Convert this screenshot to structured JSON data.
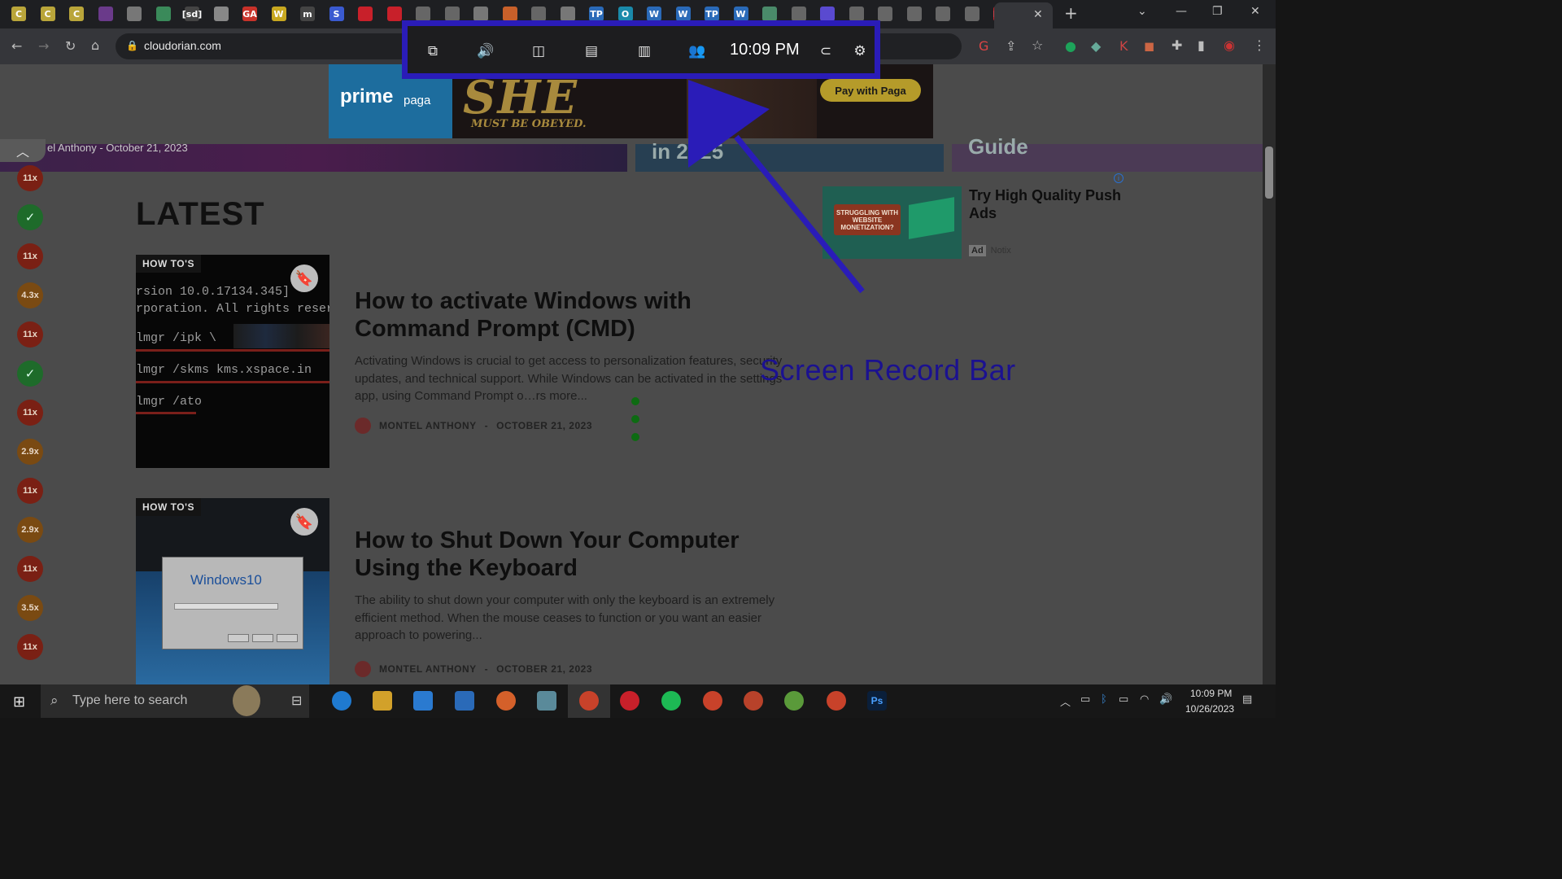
{
  "browser": {
    "url": "cloudorian.com",
    "favicons": [
      "C",
      "C",
      "C",
      "",
      "",
      "",
      "[sd]",
      "",
      "GA",
      "W",
      "m",
      "S",
      "",
      "",
      "",
      "",
      "",
      "",
      "",
      "",
      "TP",
      "O",
      "W",
      "W",
      "TP",
      "W",
      "",
      "",
      "",
      "",
      "",
      "",
      "",
      "",
      "HD",
      ""
    ],
    "new_tab": "+",
    "close_tab": "✕"
  },
  "record_bar": {
    "time": "10:09 PM"
  },
  "ad_banner": {
    "brand_prime": "prime",
    "brand_paga": "paga",
    "headline": "SHE",
    "tagline": "MUST BE OBEYED.",
    "cta": "Pay with Paga"
  },
  "hero": {
    "byline": "el Anthony - October 21, 2023",
    "mid_text": "in 2025",
    "right_text": "Guide"
  },
  "sidebar_badges": [
    "11x",
    "✓",
    "11x",
    "4.3x",
    "11x",
    "✓",
    "11x",
    "2.9x",
    "11x",
    "2.9x",
    "11x",
    "3.5x",
    "11x"
  ],
  "section": {
    "heading": "LATEST"
  },
  "articles": [
    {
      "category": "HOW TO'S",
      "title": "How to activate Windows with Command Prompt (CMD)",
      "excerpt": "Activating Windows is crucial to get access to personalization features, security updates, and technical support. While Windows can be activated in the settings app, using Command Prompt o…rs more...",
      "author": "MONTEL ANTHONY",
      "date": "OCTOBER 21, 2023",
      "code_lines": [
        "rsion 10.0.17134.345]",
        "rporation. All rights reserv",
        "lmgr /ipk \\",
        "lmgr /skms kms.xspace.in",
        "lmgr /ato"
      ]
    },
    {
      "category": "HOW TO'S",
      "title": "How to Shut Down Your Computer Using the Keyboard",
      "excerpt": "The ability to shut down your computer with only the keyboard is an extremely efficient method. When the mouse ceases to function or you want an easier approach to powering...",
      "author": "MONTEL ANTHONY",
      "date": "OCTOBER 21, 2023",
      "image_text": "Windows10"
    }
  ],
  "side_ad": {
    "badge": "STRUGGLING WITH WEBSITE MONETIZATION?",
    "title": "Try High Quality Push Ads",
    "ad_label": "Ad",
    "network": "Notix",
    "info": "i"
  },
  "annotation": {
    "label": "Screen Record Bar",
    "color": "#2a1cb8"
  },
  "taskbar": {
    "search_placeholder": "Type here to search",
    "clock_time": "10:09 PM",
    "clock_date": "10/26/2023"
  }
}
